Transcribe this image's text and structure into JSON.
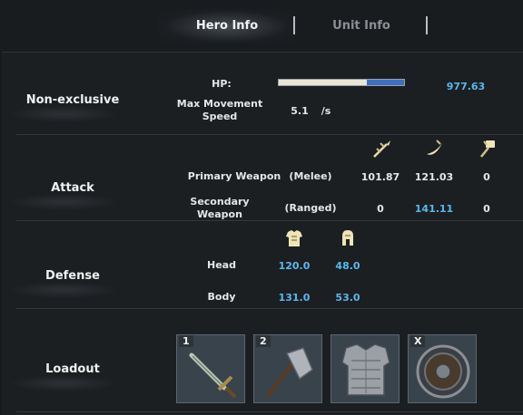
{
  "tabs": [
    {
      "label": "Hero Info",
      "active": true
    },
    {
      "label": "Unit Info",
      "active": false
    }
  ],
  "sections": {
    "nonexclusive": {
      "label": "Non-exclusive",
      "hp_label": "HP:",
      "hp_value": "977.63",
      "hp_fill_fraction": 0.3,
      "move_label": "Max Movement Speed",
      "move_value": "5.1",
      "move_unit": "/s"
    },
    "attack": {
      "label": "Attack",
      "icons": [
        "pierce-damage-icon",
        "slash-damage-icon",
        "blunt-damage-icon"
      ],
      "rows": [
        {
          "label": "Primary Weapon",
          "type": "(Melee)",
          "v1": "101.87",
          "v2": "121.03",
          "v3": "0"
        },
        {
          "label": "Secondary Weapon",
          "type": "(Ranged)",
          "v1": "0",
          "v2": "141.11",
          "v3": "0"
        }
      ]
    },
    "defense": {
      "label": "Defense",
      "icons": [
        "body-armor-icon",
        "head-armor-icon"
      ],
      "rows": [
        {
          "label": "Head",
          "v1": "120.0",
          "v2": "48.0"
        },
        {
          "label": "Body",
          "v1": "131.0",
          "v2": "53.0"
        }
      ]
    },
    "loadout": {
      "label": "Loadout",
      "slots": [
        {
          "key": "1",
          "item": "sword-icon"
        },
        {
          "key": "2",
          "item": "axe-icon"
        },
        {
          "key": "",
          "item": "chest-armor-icon"
        },
        {
          "key": "X",
          "item": "round-shield-icon"
        }
      ]
    }
  },
  "colors": {
    "highlight_value": "#58b8ee",
    "hp_bar_fill": "#3d6fc4",
    "hp_bar_empty": "#e9e6d8"
  }
}
